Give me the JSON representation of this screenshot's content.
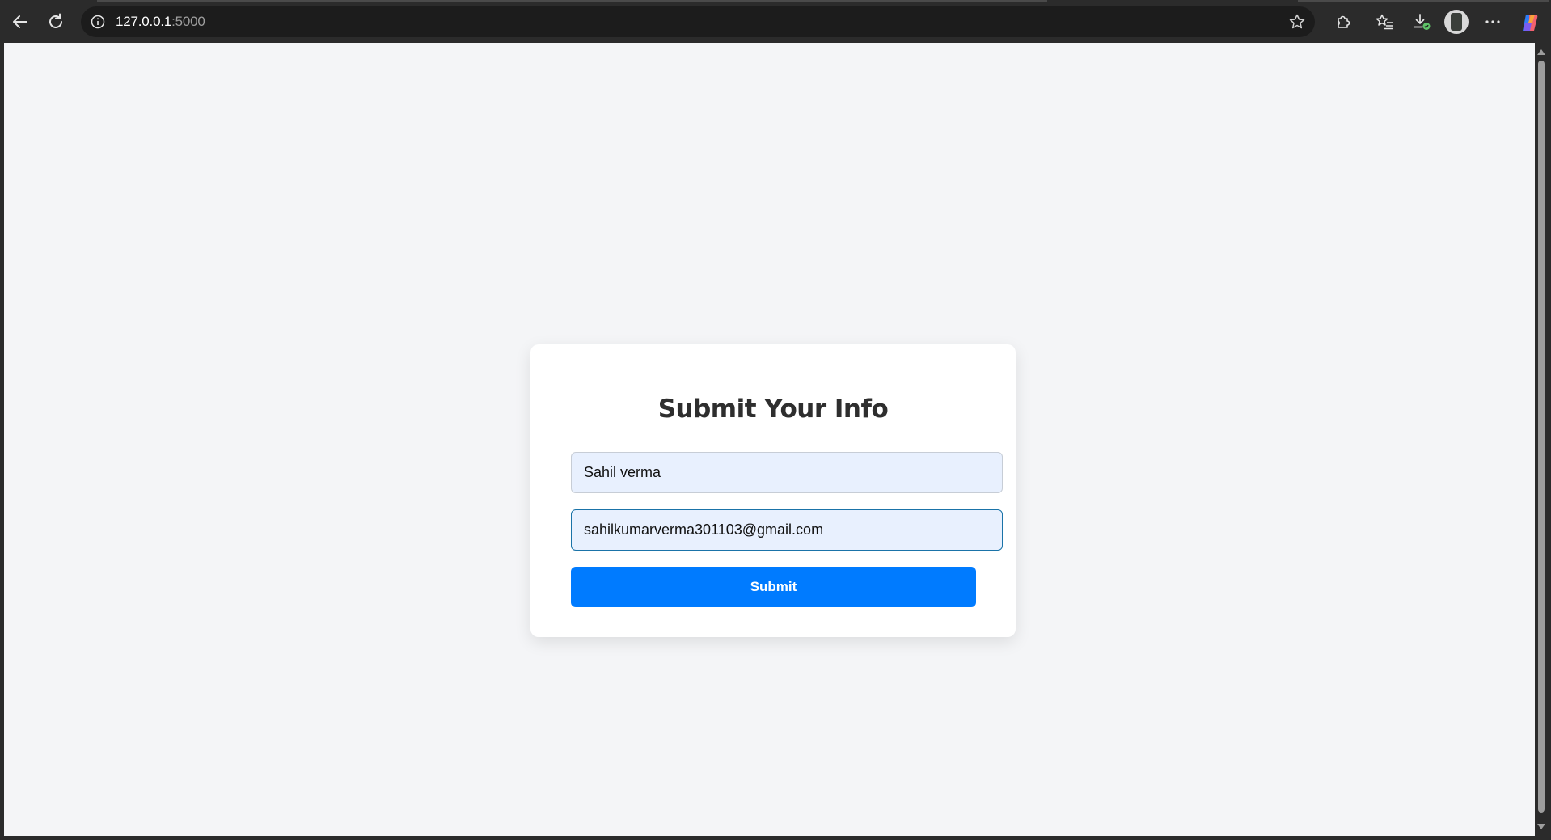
{
  "browser": {
    "url_host": "127.0.0.1",
    "url_port": ":5000",
    "icons": {
      "back": "back-arrow-icon",
      "reload": "reload-icon",
      "site_info": "info-icon",
      "favorite": "star-icon",
      "extensions": "puzzle-icon",
      "favorites": "favorites-list-icon",
      "downloads": "download-icon",
      "more": "more-icon",
      "copilot": "copilot-icon"
    }
  },
  "form": {
    "title": "Submit Your Info",
    "name_value": "Sahil verma",
    "email_value": "sahilkumarverma301103@gmail.com",
    "submit_label": "Submit"
  },
  "colors": {
    "page_bg": "#f4f5f7",
    "card_bg": "#ffffff",
    "field_bg": "#e8f0fe",
    "button_bg": "#007bff",
    "chrome_bg": "#2b2b2b"
  }
}
